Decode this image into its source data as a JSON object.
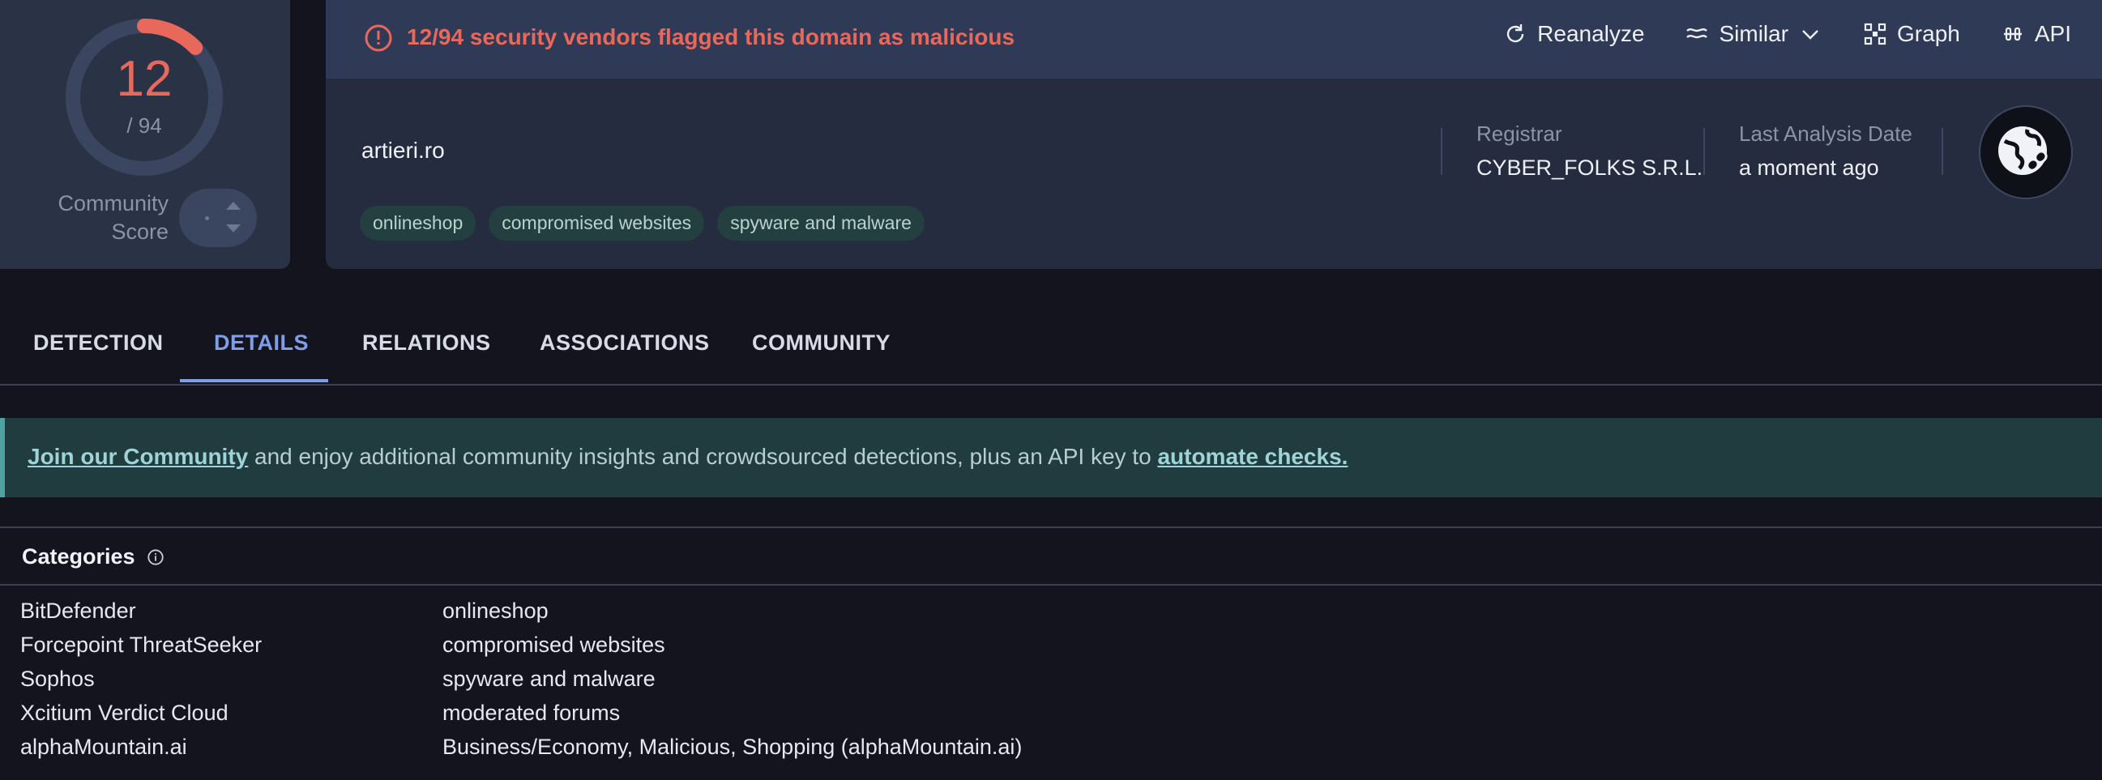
{
  "score": {
    "detections": "12",
    "total": "/ 94",
    "fraction": 0.1277,
    "community_label_1": "Community",
    "community_label_2": "Score"
  },
  "alert": {
    "text": "12/94 security vendors flagged this domain as malicious",
    "color": "#e8685c"
  },
  "actions": [
    {
      "label": "Reanalyze",
      "icon": "refresh-icon"
    },
    {
      "label": "Similar",
      "icon": "similar-icon"
    },
    {
      "label": "Graph",
      "icon": "graph-icon"
    },
    {
      "label": "API",
      "icon": "api-icon"
    }
  ],
  "domain": "artieri.ro",
  "tags": [
    "onlineshop",
    "compromised websites",
    "spyware and malware"
  ],
  "meta": {
    "registrar_label": "Registrar",
    "registrar_value": "CYBER_FOLKS S.R.L.",
    "last_analysis_label": "Last Analysis Date",
    "last_analysis_value": "a moment ago"
  },
  "tabs": [
    "DETECTION",
    "DETAILS",
    "RELATIONS",
    "ASSOCIATIONS",
    "COMMUNITY"
  ],
  "active_tab": "DETAILS",
  "banner": {
    "link1": "Join our Community",
    "middle": " and enjoy additional community insights and crowdsourced detections, plus an API key to ",
    "link2": "automate checks."
  },
  "categories": {
    "title": "Categories",
    "rows": [
      {
        "vendor": "BitDefender",
        "category": "onlineshop"
      },
      {
        "vendor": "Forcepoint ThreatSeeker",
        "category": "compromised websites"
      },
      {
        "vendor": "Sophos",
        "category": "spyware and malware"
      },
      {
        "vendor": "Xcitium Verdict Cloud",
        "category": "moderated forums"
      },
      {
        "vendor": "alphaMountain.ai",
        "category": "Business/Economy, Malicious, Shopping (alphaMountain.ai)"
      }
    ]
  }
}
